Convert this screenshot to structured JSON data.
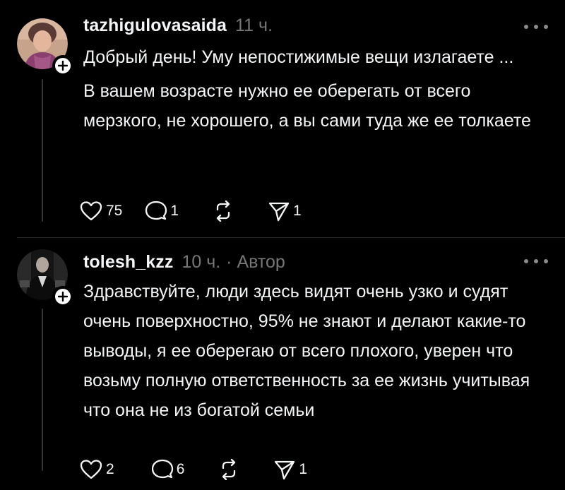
{
  "comments": [
    {
      "username": "tazhigulovasaida",
      "time": "11 ч.",
      "author_tag": "",
      "paragraphs": [
        "Добрый день! Уму непостижимые вещи излагаете ...",
        "В вашем возрасте нужно ее оберегать от всего мерзкого, не хорошего, а вы сами туда же ее толкаете"
      ],
      "likes": "75",
      "replies": "1",
      "shares": "1",
      "avatar_colors": [
        "#c9a48a",
        "#8a3f6e",
        "#4a4a55"
      ]
    },
    {
      "username": "tolesh_kzz",
      "time": "10 ч.",
      "author_tag": "· Автор",
      "paragraphs": [
        "Здравствуйте, люди здесь видят очень узко и судят очень поверхностно, 95% не знают и делают какие-то выводы, я ее оберегаю от всего плохого, уверен что возьму полную ответственность за ее жизнь учитывая что она не из богатой семьи"
      ],
      "likes": "2",
      "replies": "6",
      "shares": "1",
      "avatar_colors": [
        "#1a1a1a",
        "#3a3a3a",
        "#6a6a6a"
      ]
    }
  ],
  "icons": {
    "like": "heart-icon",
    "reply": "comment-icon",
    "repost": "repost-icon",
    "share": "send-icon",
    "more": "more-dots-icon",
    "follow": "plus-icon"
  },
  "colors": {
    "background": "#000000",
    "text": "#f3f5f7",
    "secondary": "#777777",
    "divider": "#2a2a2a"
  }
}
